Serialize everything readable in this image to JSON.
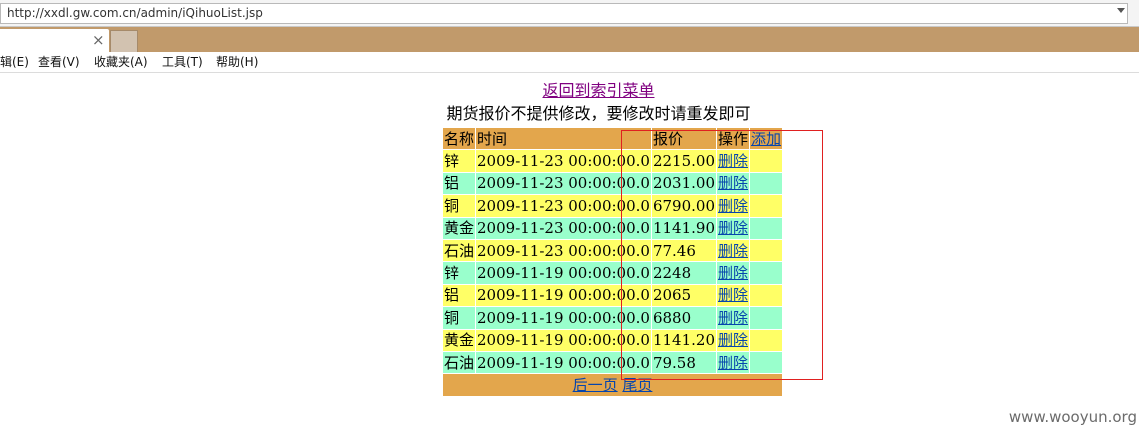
{
  "browser": {
    "url": "http://xxdl.gw.com.cn/admin/iQihuoList.jsp",
    "tab_close": "×",
    "menu": [
      "辑(E)",
      "查看(V)",
      "收藏夹(A)",
      "工具(T)",
      "帮助(H)"
    ]
  },
  "page": {
    "back_link": "返回到索引菜单",
    "notice": "期货报价不提供修改，要修改时请重发即可",
    "table": {
      "headers": {
        "name": "名称",
        "time": "时间",
        "price": "报价",
        "action": "操作",
        "add": "添加"
      },
      "rows": [
        {
          "name": "锌",
          "time": "2009-11-23 00:00:00.0",
          "price": "2215.00",
          "action": "删除"
        },
        {
          "name": "铝",
          "time": "2009-11-23 00:00:00.0",
          "price": "2031.00",
          "action": "删除"
        },
        {
          "name": "铜",
          "time": "2009-11-23 00:00:00.0",
          "price": "6790.00",
          "action": "删除"
        },
        {
          "name": "黄金",
          "time": "2009-11-23 00:00:00.0",
          "price": "1141.90",
          "action": "删除"
        },
        {
          "name": "石油",
          "time": "2009-11-23 00:00:00.0",
          "price": "77.46",
          "action": "删除"
        },
        {
          "name": "锌",
          "time": "2009-11-19 00:00:00.0",
          "price": "2248",
          "action": "删除"
        },
        {
          "name": "铝",
          "time": "2009-11-19 00:00:00.0",
          "price": "2065",
          "action": "删除"
        },
        {
          "name": "铜",
          "time": "2009-11-19 00:00:00.0",
          "price": "6880",
          "action": "删除"
        },
        {
          "name": "黄金",
          "time": "2009-11-19 00:00:00.0",
          "price": "1141.20",
          "action": "删除"
        },
        {
          "name": "石油",
          "time": "2009-11-19 00:00:00.0",
          "price": "79.58",
          "action": "删除"
        }
      ],
      "pager": {
        "next": "后一页",
        "last": "尾页"
      }
    },
    "colors": {
      "header": "#e3a64c",
      "row_yellow": "#ffff66",
      "row_green": "#99ffcc",
      "highlight_box": "#e02020"
    }
  },
  "watermark": "www.wooyun.org"
}
